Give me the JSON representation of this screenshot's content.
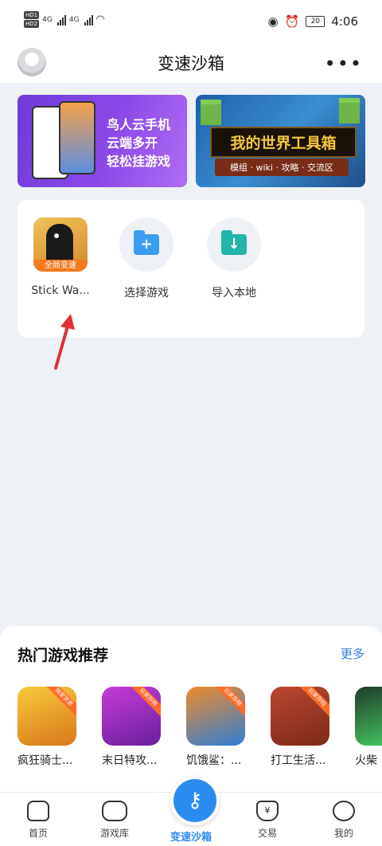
{
  "status_bar": {
    "time": "4:06",
    "battery": "20",
    "net1": "4G",
    "net2": "4G",
    "hd1": "HD1",
    "hd2": "HD2"
  },
  "header": {
    "title": "变速沙箱",
    "avatar_icon": "avatar-icon",
    "more_icon": "more-icon"
  },
  "banners": [
    {
      "line1": "鸟人云手机",
      "line2": "云端多开",
      "line3": "轻松挂游戏"
    },
    {
      "title": "我的世界工具箱",
      "subtitle": "模组 · wiki · 攻略 · 交流区"
    }
  ],
  "games": {
    "items": [
      {
        "label": "Stick Wa...",
        "tag": "全局变速"
      },
      {
        "label": "选择游戏",
        "icon": "add-folder-icon"
      },
      {
        "label": "导入本地",
        "icon": "import-folder-icon"
      }
    ]
  },
  "recommend": {
    "title": "热门游戏推荐",
    "more": "更多",
    "items": [
      {
        "name": "疯狂骑士...",
        "badge": "独家变速"
      },
      {
        "name": "末日特攻...",
        "badge": "玩家存档"
      },
      {
        "name": "饥饿鲨：...",
        "badge": "玩家存档"
      },
      {
        "name": "打工生活...",
        "badge": "玩家存档"
      },
      {
        "name": "火柴"
      }
    ]
  },
  "nav": {
    "items": [
      {
        "label": "首页",
        "icon": "home-icon"
      },
      {
        "label": "游戏库",
        "icon": "gamepad-icon"
      },
      {
        "label": "变速沙箱",
        "icon": "key-icon"
      },
      {
        "label": "交易",
        "icon": "money-bag-icon"
      },
      {
        "label": "我的",
        "icon": "profile-icon"
      }
    ]
  },
  "colors": {
    "accent": "#2b8cf0",
    "annotation_arrow": "#e0303a"
  }
}
